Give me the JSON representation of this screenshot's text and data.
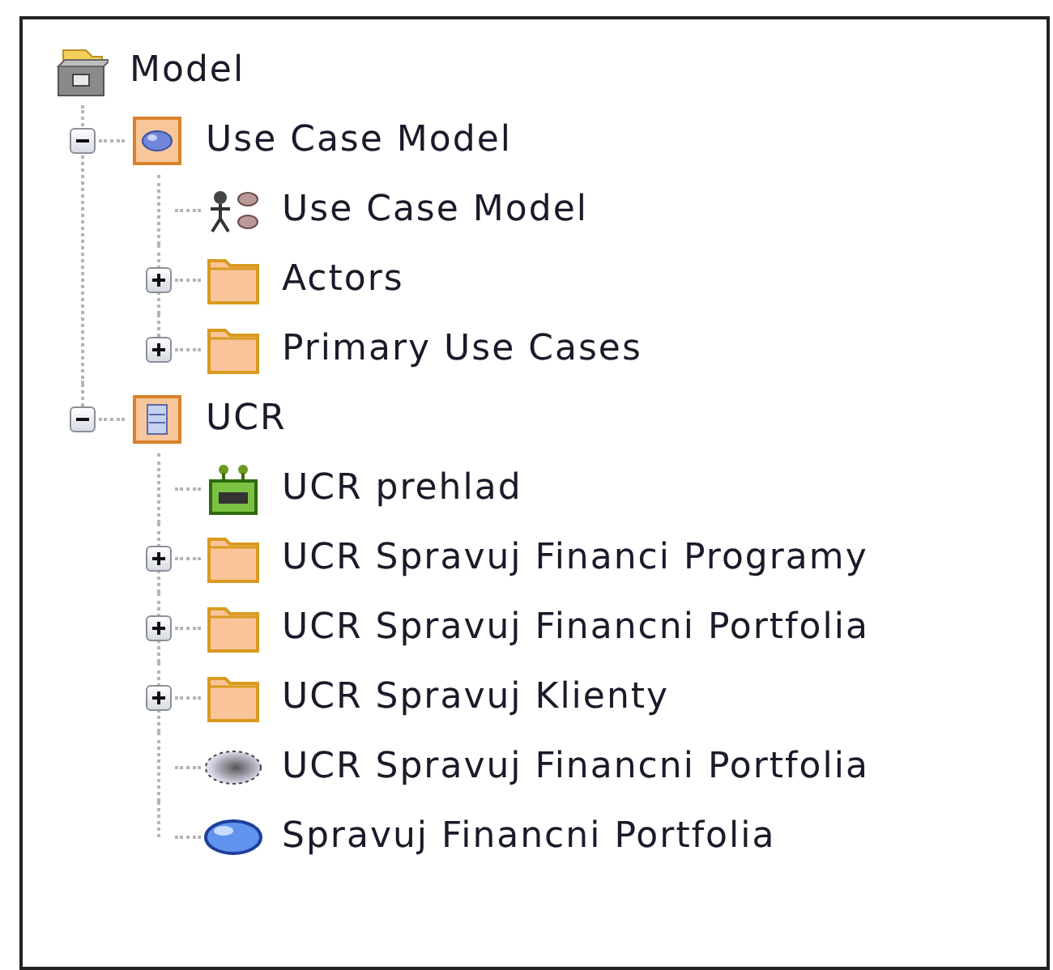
{
  "tree": {
    "label": "Model",
    "kind": "model",
    "children": [
      {
        "label": "Use Case Model",
        "kind": "usecase-package",
        "expanded": true,
        "children": [
          {
            "label": "Use Case Model",
            "kind": "usecase-diagram"
          },
          {
            "label": "Actors",
            "kind": "folder",
            "expanded": false
          },
          {
            "label": "Primary Use Cases",
            "kind": "folder",
            "expanded": false
          }
        ]
      },
      {
        "label": "UCR",
        "kind": "list-package",
        "expanded": true,
        "children": [
          {
            "label": "UCR prehlad",
            "kind": "component"
          },
          {
            "label": "UCR Spravuj Financi Programy",
            "kind": "folder",
            "expanded": false
          },
          {
            "label": "UCR Spravuj Financni Portfolia",
            "kind": "folder",
            "expanded": false
          },
          {
            "label": "UCR Spravuj Klienty",
            "kind": "folder",
            "expanded": false
          },
          {
            "label": "UCR Spravuj Financni Portfolia",
            "kind": "dotted-usecase"
          },
          {
            "label": "Spravuj Financni Portfolia",
            "kind": "usecase"
          }
        ]
      }
    ]
  }
}
